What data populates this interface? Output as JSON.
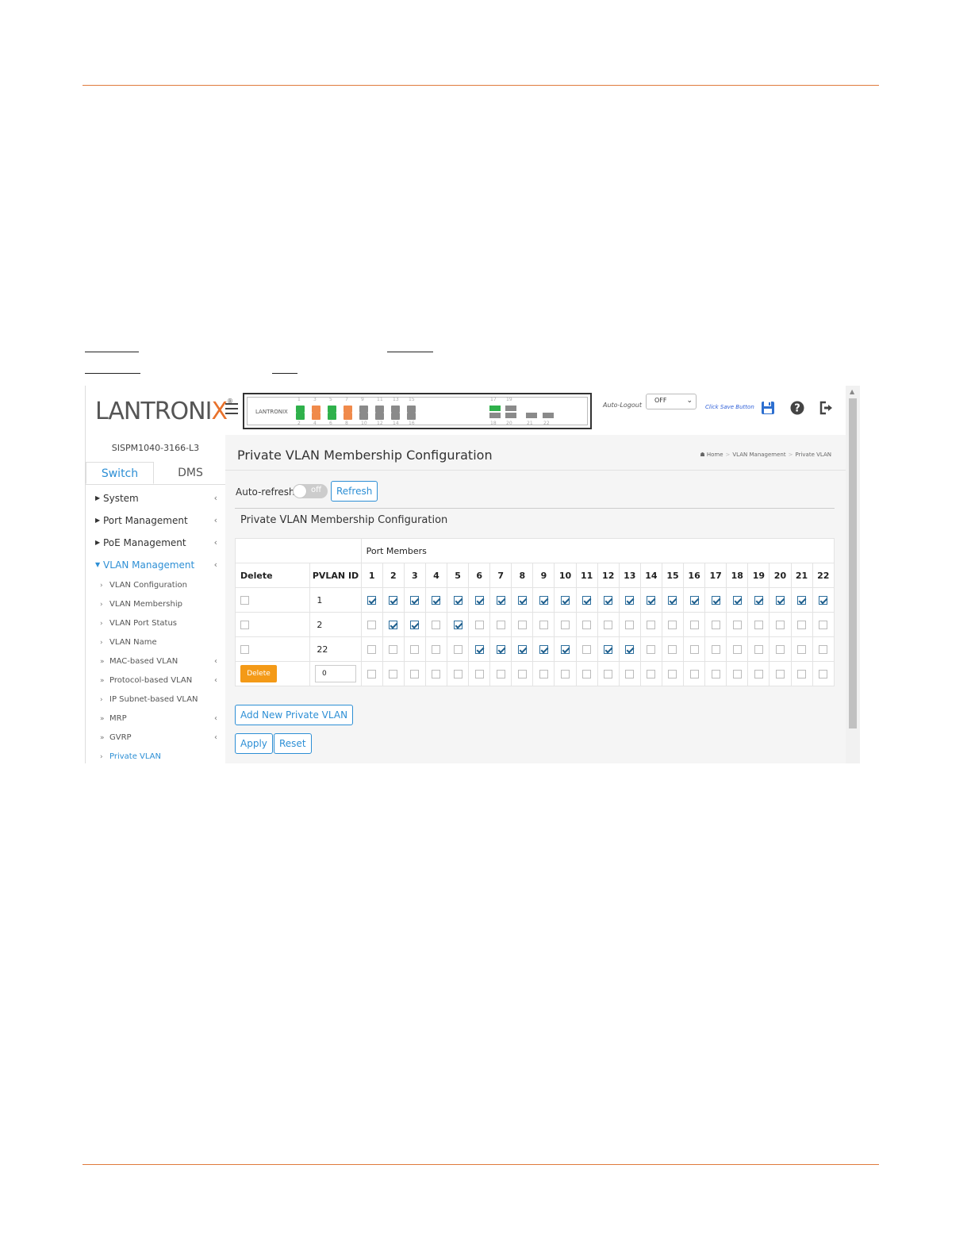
{
  "brand": {
    "logo_main": "LANTRONI",
    "logo_x": "X",
    "logo_reg": "®",
    "mini_logo": "LANTRONIX"
  },
  "switch_panel": {
    "top_port_numbers": [
      "1",
      "3",
      "5",
      "7",
      "9",
      "11",
      "13",
      "15"
    ],
    "bottom_port_numbers": [
      "2",
      "4",
      "6",
      "8",
      "10",
      "12",
      "14",
      "16"
    ],
    "sfp_top_numbers": [
      "17",
      "19"
    ],
    "sfp_bottom_numbers": [
      "18",
      "20",
      "21",
      "22"
    ],
    "colors": {
      "green": "#2fb14b",
      "orange": "#f08a4b",
      "gray": "#8a8a8a"
    }
  },
  "header": {
    "auto_logout_label": "Auto-Logout",
    "auto_logout_value": "OFF",
    "save_label": "Click Save Button",
    "icons": [
      "hamburger-icon",
      "save-icon",
      "help-icon",
      "logout-icon"
    ]
  },
  "sidebar": {
    "model": "SISPM1040-3166-L3",
    "tabs": [
      {
        "label": "Switch"
      },
      {
        "label": "DMS"
      }
    ],
    "items": [
      {
        "label": "System"
      },
      {
        "label": "Port Management"
      },
      {
        "label": "PoE Management"
      },
      {
        "label": "VLAN Management"
      }
    ],
    "subitems": [
      {
        "label": "VLAN Configuration"
      },
      {
        "label": "VLAN Membership"
      },
      {
        "label": "VLAN Port Status"
      },
      {
        "label": "VLAN Name"
      },
      {
        "label": "MAC-based VLAN"
      },
      {
        "label": "Protocol-based VLAN"
      },
      {
        "label": "IP Subnet-based VLAN"
      },
      {
        "label": "MRP"
      },
      {
        "label": "GVRP"
      },
      {
        "label": "Private VLAN"
      }
    ]
  },
  "main": {
    "title": "Private VLAN Membership Configuration",
    "breadcrumb": {
      "home": "Home",
      "section": "VLAN Management",
      "page": "Private VLAN"
    },
    "auto_refresh_label": "Auto-refresh",
    "toggle_state": "off",
    "refresh_label": "Refresh",
    "section_title": "Private VLAN Membership Configuration",
    "table": {
      "port_members_label": "Port Members",
      "delete_header": "Delete",
      "pvlan_id_header": "PVLAN ID",
      "ports": [
        "1",
        "2",
        "3",
        "4",
        "5",
        "6",
        "7",
        "8",
        "9",
        "10",
        "11",
        "12",
        "13",
        "14",
        "15",
        "16",
        "17",
        "18",
        "19",
        "20",
        "21",
        "22"
      ],
      "rows": [
        {
          "id": "1",
          "members": [
            1,
            1,
            1,
            1,
            1,
            1,
            1,
            1,
            1,
            1,
            1,
            1,
            1,
            1,
            1,
            1,
            1,
            1,
            1,
            1,
            1,
            1
          ]
        },
        {
          "id": "2",
          "members": [
            0,
            1,
            1,
            0,
            1,
            0,
            0,
            0,
            0,
            0,
            0,
            0,
            0,
            0,
            0,
            0,
            0,
            0,
            0,
            0,
            0,
            0
          ]
        },
        {
          "id": "22",
          "members": [
            0,
            0,
            0,
            0,
            0,
            1,
            1,
            1,
            1,
            1,
            0,
            1,
            1,
            0,
            0,
            0,
            0,
            0,
            0,
            0,
            0,
            0
          ]
        }
      ],
      "new_row": {
        "delete_label": "Delete",
        "id_value": "0"
      }
    },
    "add_button_label": "Add New Private VLAN",
    "apply_label": "Apply",
    "reset_label": "Reset"
  }
}
